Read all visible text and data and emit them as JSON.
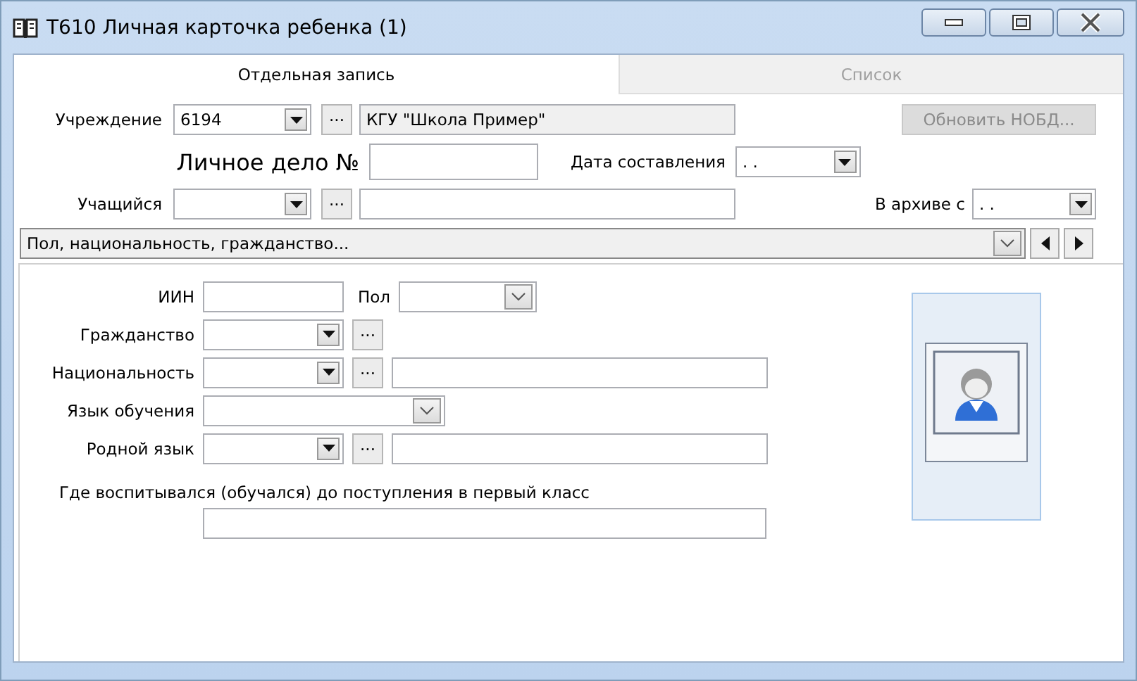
{
  "window": {
    "title": "Т610 Личная карточка ребенка (1)"
  },
  "tabs": [
    {
      "label": "Отдельная запись",
      "selected": true
    },
    {
      "label": "Список",
      "selected": false
    }
  ],
  "institution": {
    "label": "Учреждение",
    "code": "6194",
    "lookup_button": "...",
    "name": "КГУ \"Школа Пример\""
  },
  "update_button": {
    "label": "Обновить НОБД...",
    "disabled": true
  },
  "personal_file": {
    "label": "Личное дело №"
  },
  "date_compiled": {
    "label": "Дата составления",
    "value": ". ."
  },
  "student": {
    "label": "Учащийся",
    "lookup_button": "..."
  },
  "archive": {
    "label": "В архиве с",
    "value": ". ."
  },
  "section_select": {
    "value": "Пол, национальность, гражданство..."
  },
  "form_rows": [
    {
      "kind": "id_gender",
      "label": "ИИН",
      "gender_label": "Пол"
    },
    {
      "kind": "lookup",
      "label": "Гражданство",
      "lookup_button": "..."
    },
    {
      "kind": "lookup_named",
      "label": "Национальность",
      "lookup_button": "..."
    },
    {
      "kind": "select",
      "label": "Язык обучения"
    },
    {
      "kind": "lookup_named",
      "label": "Родной язык",
      "lookup_button": "..."
    },
    {
      "kind": "note",
      "label": "Где воспитывался (обучался) до поступления в первый класс"
    }
  ]
}
